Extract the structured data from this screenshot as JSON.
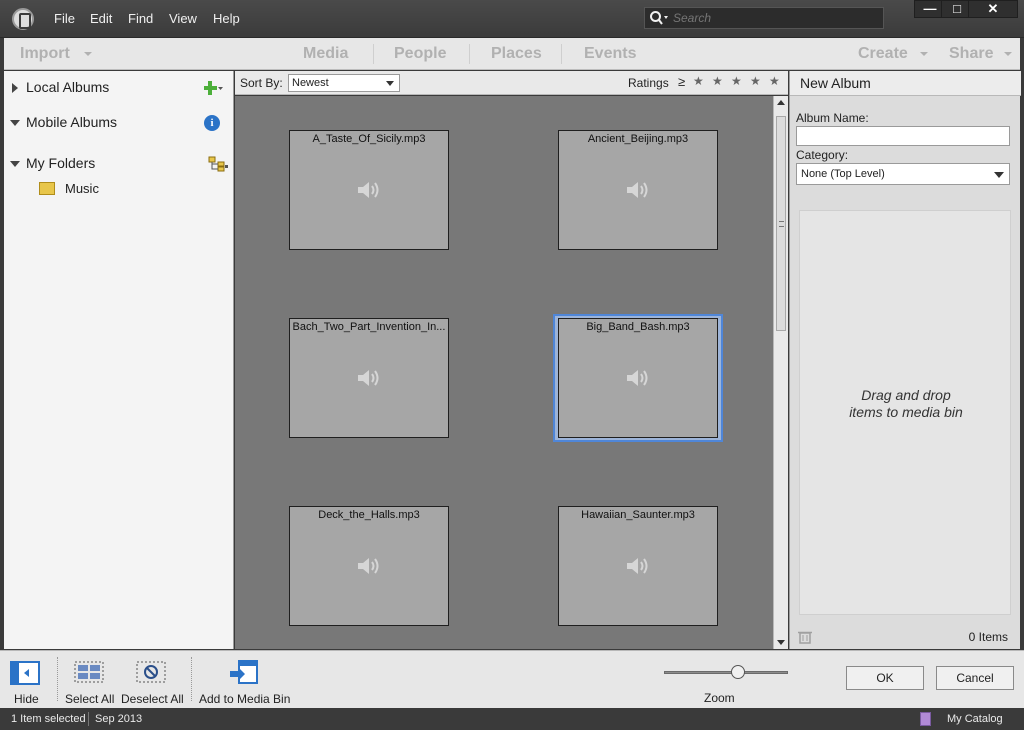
{
  "menu": {
    "items": [
      "File",
      "Edit",
      "Find",
      "View",
      "Help"
    ],
    "search_placeholder": "Search"
  },
  "window_controls": {
    "minimize": "—",
    "maximize": "□",
    "close": "✕"
  },
  "nav": {
    "import": "Import",
    "tabs": [
      "Media",
      "People",
      "Places",
      "Events"
    ],
    "create": "Create",
    "share": "Share"
  },
  "left_panel": {
    "local_albums": "Local Albums",
    "mobile_albums": "Mobile Albums",
    "info_glyph": "i",
    "my_folders": "My Folders",
    "folder": "Music"
  },
  "sort": {
    "label": "Sort By:",
    "value": "Newest",
    "ratings_label": "Ratings",
    "ratings_operator": "≥",
    "stars": [
      "★",
      "★",
      "★",
      "★",
      "★"
    ]
  },
  "media": {
    "items": [
      {
        "name": "A_Taste_Of_Sicily.mp3",
        "selected": false
      },
      {
        "name": "Ancient_Beijing.mp3",
        "selected": false
      },
      {
        "name": "Bach_Two_Part_Invention_In...",
        "selected": false
      },
      {
        "name": "Big_Band_Bash.mp3",
        "selected": true
      },
      {
        "name": "Deck_the_Halls.mp3",
        "selected": false
      },
      {
        "name": "Hawaiian_Saunter.mp3",
        "selected": false
      }
    ]
  },
  "album_panel": {
    "title": "New Album",
    "album_name_label": "Album Name:",
    "album_name_value": "",
    "category_label": "Category:",
    "category_value": "None (Top Level)",
    "drop_hint": "Drag and drop items to media bin",
    "items_count": "0 Items"
  },
  "bottom_toolbar": {
    "hide": "Hide",
    "select_all": "Select All",
    "deselect_all": "Deselect All",
    "add_to_bin": "Add to Media Bin",
    "zoom": "Zoom",
    "zoom_fraction": 0.6,
    "ok": "OK",
    "cancel": "Cancel"
  },
  "status": {
    "selected": "1 Item selected",
    "date": "Sep 2013",
    "catalog": "My Catalog"
  },
  "colors": {
    "selection_accent": "#4f86d8",
    "info_blue": "#2b73c7",
    "add_green": "#4caf3a",
    "folder_yellow": "#e8c64a"
  }
}
